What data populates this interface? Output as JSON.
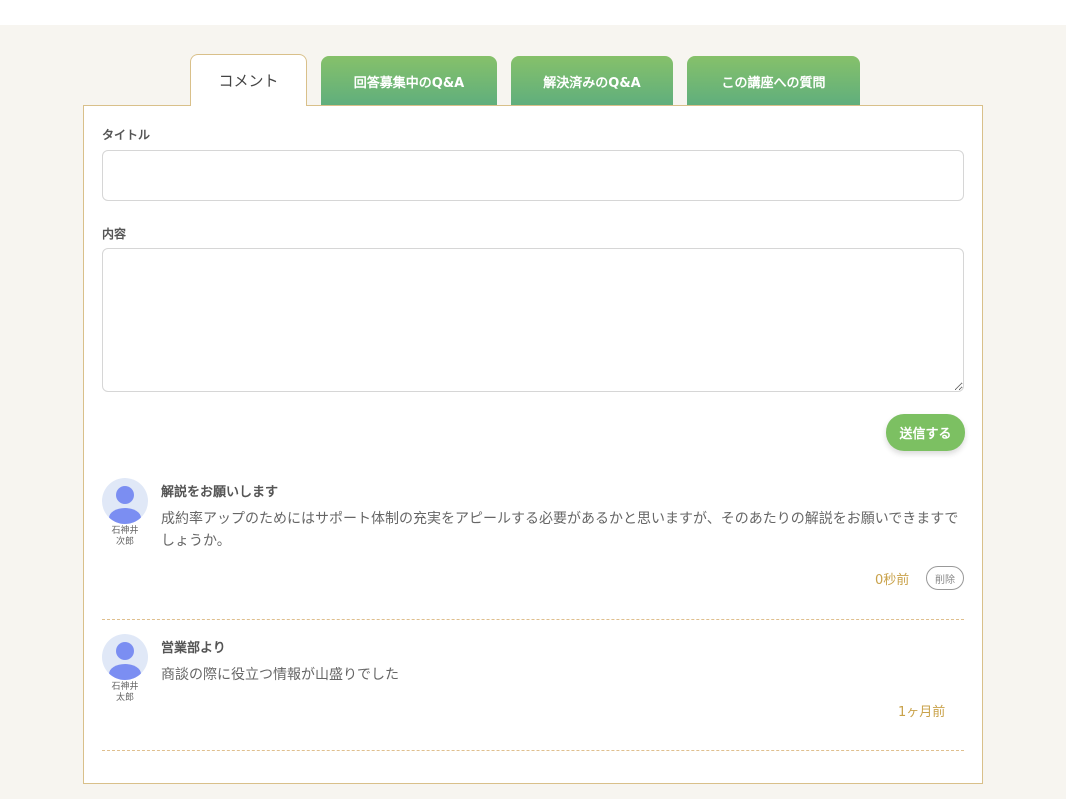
{
  "tabs": [
    {
      "label": "コメント",
      "active": true
    },
    {
      "label": "回答募集中のQ&A",
      "active": false
    },
    {
      "label": "解決済みのQ&A",
      "active": false
    },
    {
      "label": "この講座への質問",
      "active": false
    }
  ],
  "form": {
    "title_label": "タイトル",
    "title_value": "",
    "content_label": "内容",
    "content_value": "",
    "submit_label": "送信する"
  },
  "comments": [
    {
      "title": "解説をお願いします",
      "body": "成約率アップのためにはサポート体制の充実をアピールする必要があるかと思いますが、そのあたりの解説をお願いできますでしょうか。",
      "user_line1": "石神井",
      "user_line2": "次郎",
      "time": "0秒前",
      "delete_label": "削除"
    },
    {
      "title": "営業部より",
      "body": "商談の際に役立つ情報が山盛りでした",
      "user_line1": "石神井",
      "user_line2": "太郎",
      "time": "1ヶ月前"
    }
  ],
  "colors": {
    "tab_green": "#6fb872",
    "accent_gold": "#c9a24a",
    "border_gold": "#d9c08a",
    "avatar_blue": "#7b8ef2"
  }
}
